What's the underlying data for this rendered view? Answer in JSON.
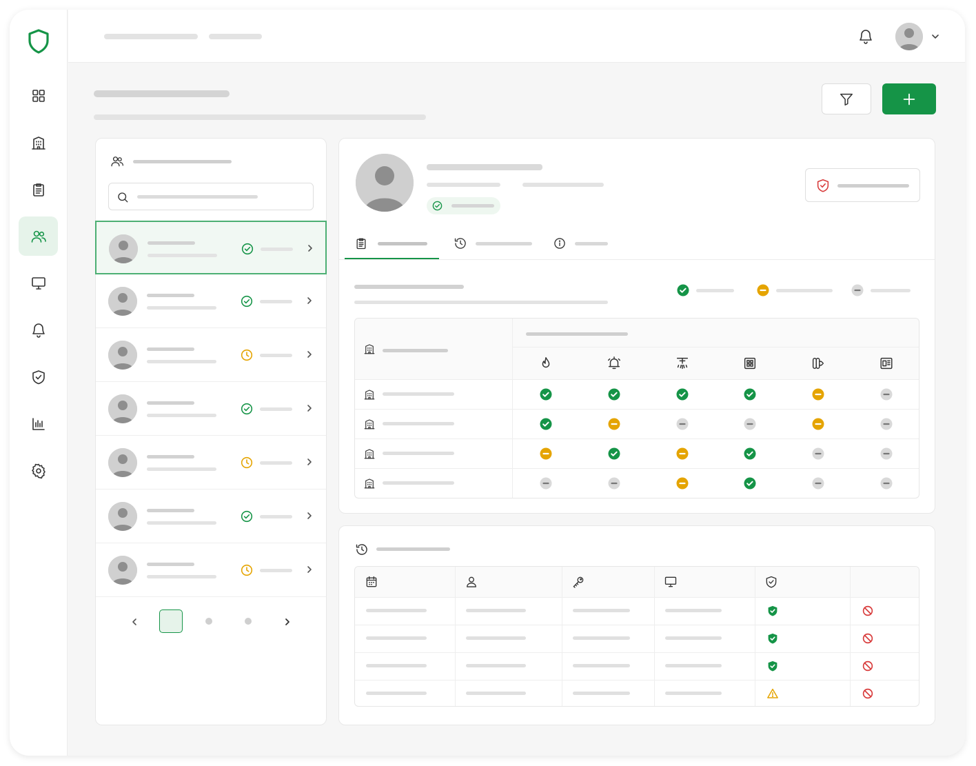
{
  "colors": {
    "accent": "#159447",
    "accent_light": "#e6f3ea",
    "warning": "#e5a400",
    "neutral": "#bdbdbd",
    "danger": "#d83b3b"
  },
  "sidebar": {
    "logo_icon": "shield-logo-icon",
    "items": [
      {
        "icon": "grid-icon",
        "active": false
      },
      {
        "icon": "building-icon",
        "active": false
      },
      {
        "icon": "clipboard-icon",
        "active": false
      },
      {
        "icon": "users-icon",
        "active": true
      },
      {
        "icon": "monitor-icon",
        "active": false
      },
      {
        "icon": "bell-icon",
        "active": false
      },
      {
        "icon": "shield-check-icon",
        "active": false
      },
      {
        "icon": "bar-chart-icon",
        "active": false
      },
      {
        "icon": "gear-icon",
        "active": false
      }
    ]
  },
  "topbar": {
    "icons": [
      "bell-icon",
      "avatar",
      "chevron-down-icon"
    ]
  },
  "people_list": {
    "header_icon": "users-icon",
    "search_icon": "search-icon",
    "items": [
      {
        "status": "ok",
        "selected": true
      },
      {
        "status": "ok",
        "selected": false
      },
      {
        "status": "pending",
        "selected": false
      },
      {
        "status": "ok",
        "selected": false
      },
      {
        "status": "pending",
        "selected": false
      },
      {
        "status": "ok",
        "selected": false
      },
      {
        "status": "pending",
        "selected": false
      }
    ],
    "pagination": {
      "current_page": 1,
      "pages": 3
    }
  },
  "profile": {
    "verified_status": "ok",
    "tabs": [
      {
        "icon": "clipboard-icon",
        "active": true
      },
      {
        "icon": "history-icon",
        "active": false
      },
      {
        "icon": "info-icon",
        "active": false
      }
    ],
    "legend": [
      "ok",
      "pending",
      "none"
    ]
  },
  "access_matrix": {
    "row_icon": "building-icon",
    "column_icons": [
      "fire-icon",
      "alarm-icon",
      "sprinkler-icon",
      "panel-icon",
      "door-icon",
      "badge-reader-icon"
    ],
    "rows": [
      [
        "ok",
        "ok",
        "ok",
        "ok",
        "pending",
        "none"
      ],
      [
        "ok",
        "pending",
        "none",
        "none",
        "pending",
        "none"
      ],
      [
        "pending",
        "ok",
        "pending",
        "ok",
        "none",
        "none"
      ],
      [
        "none",
        "none",
        "pending",
        "ok",
        "none",
        "none"
      ]
    ]
  },
  "activity_log": {
    "header_icon": "history-icon",
    "column_icons": [
      "calendar-icon",
      "user-icon",
      "key-icon",
      "monitor-icon",
      "shield-check-icon",
      ""
    ],
    "rows": [
      {
        "shield": "ok",
        "action": "blocked"
      },
      {
        "shield": "ok",
        "action": "blocked"
      },
      {
        "shield": "ok",
        "action": "blocked"
      },
      {
        "shield": "warning",
        "action": "blocked"
      }
    ]
  }
}
